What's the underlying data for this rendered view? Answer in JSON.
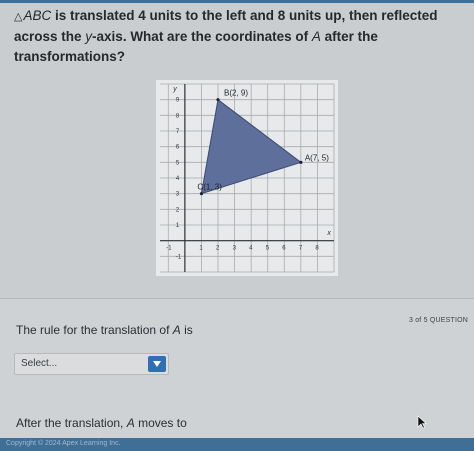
{
  "question": {
    "triangle_symbol": "△",
    "triangle_name": "ABC",
    "part1": " is translated 4 units to the left and 8 units up, then reflected across the ",
    "axis_var": "y",
    "part2": "-axis. What are the coordinates of ",
    "point_var": "A",
    "part3": " after the transformations?"
  },
  "graph": {
    "axis_x_label": "x",
    "axis_y_label": "y",
    "x_ticks": [
      -1,
      1,
      2,
      3,
      4,
      5,
      6,
      7,
      8
    ],
    "y_ticks": [
      -1,
      1,
      2,
      3,
      4,
      5,
      6,
      7,
      8,
      9
    ],
    "x_range": [
      -1.5,
      9
    ],
    "y_range": [
      -2,
      10
    ],
    "triangle_fill": "#5d6f9a",
    "points": [
      {
        "label": "B(2, 9)",
        "x": 2,
        "y": 9
      },
      {
        "label": "A(7, 5)",
        "x": 7,
        "y": 5
      },
      {
        "label": "C(1, 3)",
        "x": 1,
        "y": 3
      }
    ]
  },
  "progress_text": "3 of 5 QUESTION",
  "rule": {
    "prefix": "The rule for the translation of ",
    "var": "A",
    "suffix": " is"
  },
  "select": {
    "value": "Select...",
    "accent": "#2f6fb3"
  },
  "after": {
    "prefix": "After the translation, ",
    "var": "A",
    "suffix": " moves to"
  },
  "footer_text": "Copyright © 2024 Apex Learning Inc."
}
